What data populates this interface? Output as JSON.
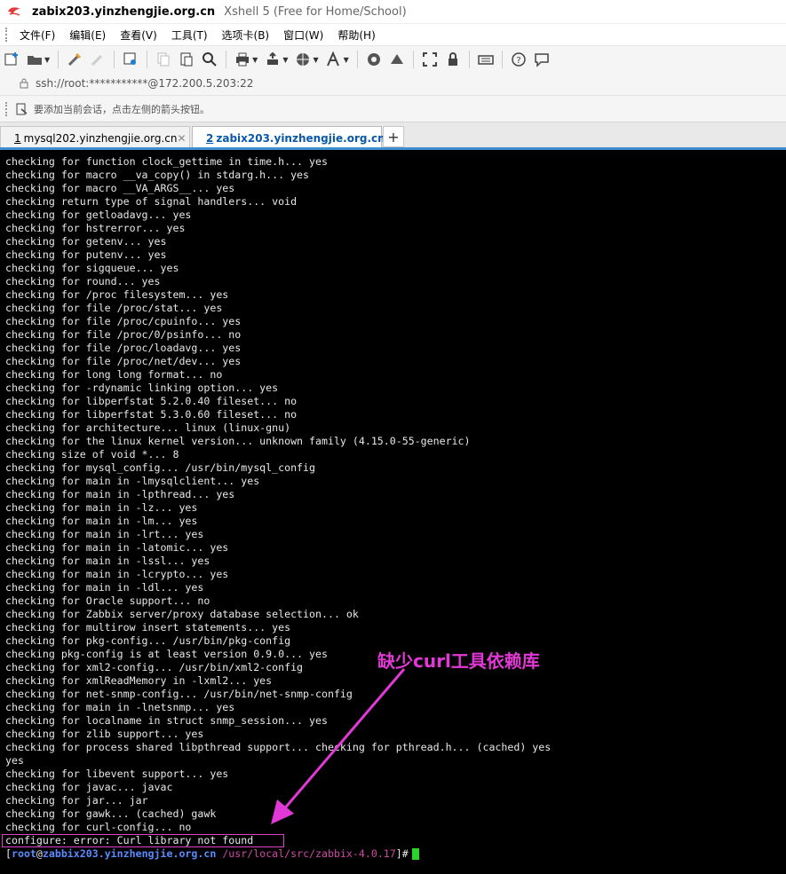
{
  "window": {
    "title_host": "zabix203.yinzhengjie.org.cn",
    "title_app": "Xshell 5 (Free for Home/School)"
  },
  "menu": {
    "items": [
      "文件(F)",
      "编辑(E)",
      "查看(V)",
      "工具(T)",
      "选项卡(B)",
      "窗口(W)",
      "帮助(H)"
    ]
  },
  "toolbar": {
    "icons": [
      "new-session-icon",
      "open-folder-icon",
      "reconnect-icon",
      "disconnect-icon",
      "properties-icon",
      "copy-icon",
      "paste-icon",
      "find-icon",
      "print-icon",
      "transfer-icon",
      "scripts-icon",
      "globe-icon",
      "font-icon",
      "xftp-icon",
      "xmanager-icon",
      "fullscreen-icon",
      "lock-icon",
      "keyboard-icon",
      "help-icon",
      "chat-icon"
    ]
  },
  "address": {
    "url": "ssh://root:***********@172.200.5.203:22"
  },
  "hint": {
    "text": "要添加当前会话，点击左侧的箭头按钮。"
  },
  "tabs": [
    {
      "num": "1",
      "label": "mysql202.yinzhengjie.org.cn",
      "active": false
    },
    {
      "num": "2",
      "label": "zabix203.yinzhengjie.org.cn",
      "active": true
    }
  ],
  "terminal": {
    "lines": [
      "checking for function clock_gettime in time.h... yes",
      "checking for macro __va_copy() in stdarg.h... yes",
      "checking for macro __VA_ARGS__... yes",
      "checking return type of signal handlers... void",
      "checking for getloadavg... yes",
      "checking for hstrerror... yes",
      "checking for getenv... yes",
      "checking for putenv... yes",
      "checking for sigqueue... yes",
      "checking for round... yes",
      "checking for /proc filesystem... yes",
      "checking for file /proc/stat... yes",
      "checking for file /proc/cpuinfo... yes",
      "checking for file /proc/0/psinfo... no",
      "checking for file /proc/loadavg... yes",
      "checking for file /proc/net/dev... yes",
      "checking for long long format... no",
      "checking for -rdynamic linking option... yes",
      "checking for libperfstat 5.2.0.40 fileset... no",
      "checking for libperfstat 5.3.0.60 fileset... no",
      "checking for architecture... linux (linux-gnu)",
      "checking for the linux kernel version... unknown family (4.15.0-55-generic)",
      "checking size of void *... 8",
      "checking for mysql_config... /usr/bin/mysql_config",
      "checking for main in -lmysqlclient... yes",
      "checking for main in -lpthread... yes",
      "checking for main in -lz... yes",
      "checking for main in -lm... yes",
      "checking for main in -lrt... yes",
      "checking for main in -latomic... yes",
      "checking for main in -lssl... yes",
      "checking for main in -lcrypto... yes",
      "checking for main in -ldl... yes",
      "checking for Oracle support... no",
      "checking for Zabbix server/proxy database selection... ok",
      "checking for multirow insert statements... yes",
      "checking for pkg-config... /usr/bin/pkg-config",
      "checking pkg-config is at least version 0.9.0... yes",
      "checking for xml2-config... /usr/bin/xml2-config",
      "checking for xmlReadMemory in -lxml2... yes",
      "checking for net-snmp-config... /usr/bin/net-snmp-config",
      "checking for main in -lnetsnmp... yes",
      "checking for localname in struct snmp_session... yes",
      "checking for zlib support... yes",
      "checking for process shared libpthread support... checking for pthread.h... (cached) yes",
      "yes",
      "checking for libevent support... yes",
      "checking for javac... javac",
      "checking for jar... jar",
      "checking for gawk... (cached) gawk",
      "checking for curl-config... no",
      "configure: error: Curl library not found"
    ],
    "prompt": {
      "user": "root",
      "host": "zabbix203.yinzhengjie.org.cn",
      "path": "/usr/local/src/zabbix-4.0.17",
      "suffix": "#"
    }
  },
  "annotation": {
    "text": "缺少curl工具依赖库",
    "color": "#e238d6"
  }
}
